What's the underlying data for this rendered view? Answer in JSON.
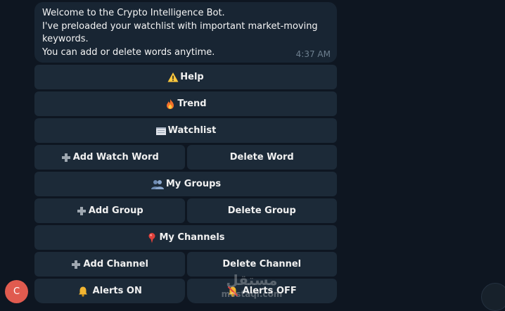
{
  "message": {
    "lines": [
      "Welcome to the Crypto Intelligence Bot.",
      "I've preloaded your watchlist with important market-moving",
      "keywords.",
      "You can add or delete words anytime."
    ],
    "time": "4:37 AM"
  },
  "keyboard": {
    "help": {
      "icon": "warning-icon",
      "label": "Help"
    },
    "trend": {
      "icon": "fire-icon",
      "label": "Trend"
    },
    "watchlist": {
      "icon": "notepad-icon",
      "label": "Watchlist"
    },
    "add_watch_word": {
      "icon": "plus-icon",
      "label": "Add Watch Word"
    },
    "delete_word": {
      "label": "Delete Word"
    },
    "my_groups": {
      "icon": "people-icon",
      "label": "My Groups"
    },
    "add_group": {
      "icon": "plus-icon",
      "label": "Add Group"
    },
    "delete_group": {
      "label": "Delete Group"
    },
    "my_channels": {
      "icon": "pin-icon",
      "label": "My Channels"
    },
    "add_channel": {
      "icon": "plus-icon",
      "label": "Add Channel"
    },
    "delete_channel": {
      "label": "Delete Channel"
    },
    "alerts_on": {
      "icon": "bell-icon",
      "label": "Alerts ON"
    },
    "alerts_off": {
      "icon": "bell-muted-icon",
      "label": "Alerts OFF"
    }
  },
  "avatar": {
    "initial": "C",
    "color": "#e05b4f"
  },
  "watermark": {
    "arabic": "مستقل",
    "latin": "mostaql.com"
  },
  "colors": {
    "background": "#0e1621",
    "bubble": "#182533",
    "button": "#1c2a38",
    "time": "#6d7f8f"
  }
}
